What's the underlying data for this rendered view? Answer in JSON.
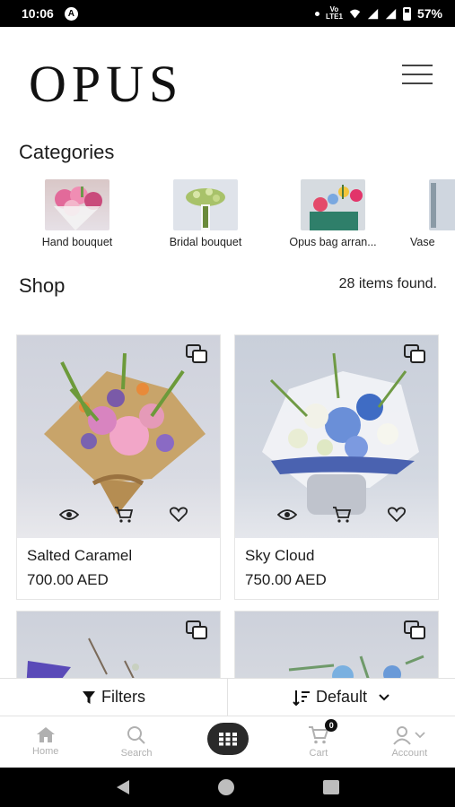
{
  "status_bar": {
    "time": "10:06",
    "battery": "57%",
    "volte": "Vo LTE1"
  },
  "header": {
    "logo": "OPUS"
  },
  "categories": {
    "title": "Categories",
    "items": [
      {
        "label": "Hand bouquet"
      },
      {
        "label": "Bridal bouquet"
      },
      {
        "label": "Opus bag arran..."
      },
      {
        "label": "Vase"
      }
    ]
  },
  "shop": {
    "title": "Shop",
    "items_found": "28 items found.",
    "products": [
      {
        "name": "Salted Caramel",
        "price": "700.00 AED"
      },
      {
        "name": "Sky Cloud",
        "price": "750.00 AED"
      }
    ]
  },
  "filter_bar": {
    "filters_label": "Filters",
    "sort_label": "Default"
  },
  "bottom_nav": {
    "items": [
      {
        "label": "Home",
        "icon": "home-icon"
      },
      {
        "label": "Search",
        "icon": "search-icon"
      },
      {
        "label": "",
        "icon": "grid-icon"
      },
      {
        "label": "Cart",
        "icon": "cart-icon",
        "badge": "0"
      },
      {
        "label": "Account",
        "icon": "user-icon"
      }
    ]
  },
  "colors": {
    "accent_dark": "#2a2a2a",
    "muted": "#b0b0b0",
    "background": "#ffffff"
  }
}
